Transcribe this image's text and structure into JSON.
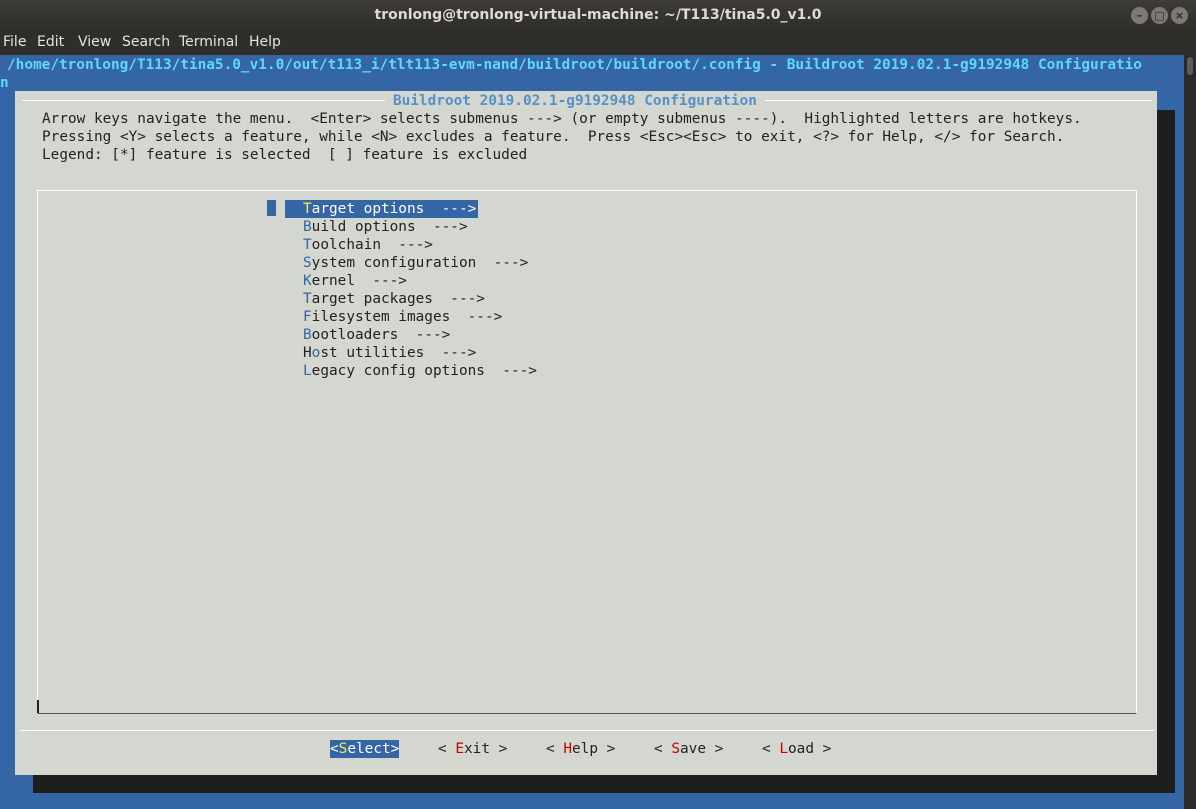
{
  "window": {
    "title": "tronlong@tronlong-virtual-machine: ~/T113/tina5.0_v1.0",
    "buttons": [
      "minimize-icon",
      "maximize-icon",
      "close-icon"
    ]
  },
  "menubar": [
    "File",
    "Edit",
    "View",
    "Search",
    "Terminal",
    "Help"
  ],
  "terminal": {
    "path_line": "/home/tronlong/T113/tina5.0_v1.0/out/t113_i/tlt113-evm-nand/buildroot/buildroot/.config - Buildroot 2019.02.1-g9192948 Configuratio",
    "cursor_line": "n"
  },
  "dialog": {
    "title": "Buildroot 2019.02.1-g9192948 Configuration",
    "help_lines": [
      "Arrow keys navigate the menu.  <Enter> selects submenus ---> (or empty submenus ----).  Highlighted letters are hotkeys.",
      "Pressing <Y> selects a feature, while <N> excludes a feature.  Press <Esc><Esc> to exit, <?> for Help, </> for Search.",
      "Legend: [*] feature is selected  [ ] feature is excluded"
    ],
    "menu_items": [
      {
        "pre": "",
        "hk": "T",
        "rest": "arget options  --->",
        "selected": true
      },
      {
        "pre": "",
        "hk": "B",
        "rest": "uild options  --->",
        "selected": false
      },
      {
        "pre": "",
        "hk": "T",
        "rest": "oolchain  --->",
        "selected": false
      },
      {
        "pre": "",
        "hk": "S",
        "rest": "ystem configuration  --->",
        "selected": false
      },
      {
        "pre": "",
        "hk": "K",
        "rest": "ernel  --->",
        "selected": false
      },
      {
        "pre": "",
        "hk": "T",
        "rest": "arget packages  --->",
        "selected": false
      },
      {
        "pre": "",
        "hk": "F",
        "rest": "ilesystem images  --->",
        "selected": false
      },
      {
        "pre": "",
        "hk": "B",
        "rest": "ootloaders  --->",
        "selected": false
      },
      {
        "pre": "H",
        "hk": "o",
        "rest": "st utilities  --->",
        "selected": false
      },
      {
        "pre": "",
        "hk": "L",
        "rest": "egacy config options  --->",
        "selected": false
      }
    ],
    "buttons": [
      {
        "pre": "<",
        "hk": "S",
        "rest": "elect>",
        "selected": true
      },
      {
        "pre": "< ",
        "hk": "E",
        "rest": "xit >",
        "selected": false
      },
      {
        "pre": "< ",
        "hk": "H",
        "rest": "elp >",
        "selected": false
      },
      {
        "pre": "< ",
        "hk": "S",
        "rest": "ave >",
        "selected": false
      },
      {
        "pre": "< ",
        "hk": "L",
        "rest": "oad >",
        "selected": false
      }
    ]
  },
  "colors": {
    "terminal_bg": "#3465a4",
    "dialog_bg": "#d3d7cf",
    "title_text": "#5590c8",
    "hotkey": "#3465a4",
    "button_hotkey": "#cc0000",
    "selected_hotkey": "#fce94f"
  }
}
